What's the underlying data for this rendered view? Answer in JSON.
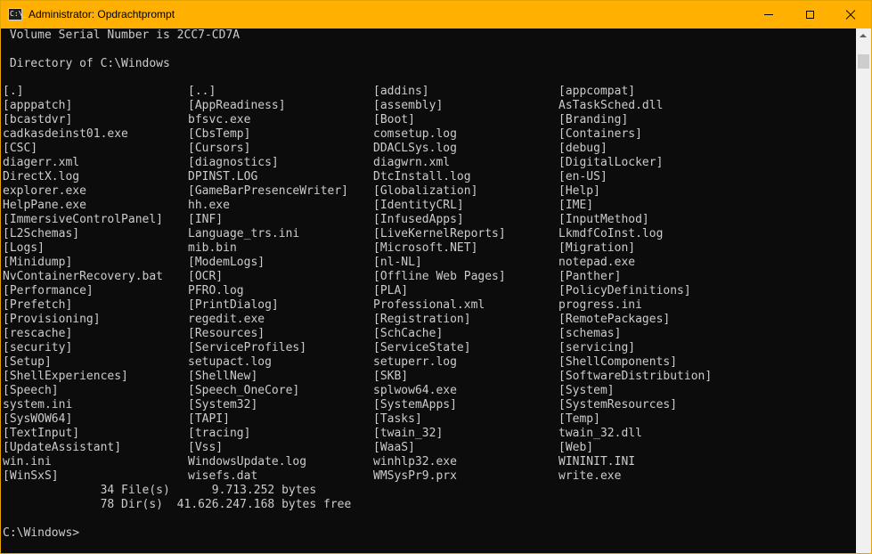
{
  "window": {
    "title": "Administrator: Opdrachtprompt",
    "icon": "cmd-icon",
    "icon_text": "C:\\_"
  },
  "colors": {
    "titlebar": "#ffb000",
    "console_bg": "#0c0c0c",
    "console_text": "#cccccc"
  },
  "console": {
    "serial_line": " Volume Serial Number is 2CC7-CD7A",
    "directory_line": " Directory of C:\\Windows",
    "entries": [
      "[.]",
      "[..]",
      "[addins]",
      "[appcompat]",
      "[apppatch]",
      "[AppReadiness]",
      "[assembly]",
      "AsTaskSched.dll",
      "[bcastdvr]",
      "bfsvc.exe",
      "[Boot]",
      "[Branding]",
      "cadkasdeinst01.exe",
      "[CbsTemp]",
      "comsetup.log",
      "[Containers]",
      "[CSC]",
      "[Cursors]",
      "DDACLSys.log",
      "[debug]",
      "diagerr.xml",
      "[diagnostics]",
      "diagwrn.xml",
      "[DigitalLocker]",
      "DirectX.log",
      "DPINST.LOG",
      "DtcInstall.log",
      "[en-US]",
      "explorer.exe",
      "[GameBarPresenceWriter]",
      "[Globalization]",
      "[Help]",
      "HelpPane.exe",
      "hh.exe",
      "[IdentityCRL]",
      "[IME]",
      "[ImmersiveControlPanel]",
      "[INF]",
      "[InfusedApps]",
      "[InputMethod]",
      "[L2Schemas]",
      "Language_trs.ini",
      "[LiveKernelReports]",
      "LkmdfCoInst.log",
      "[Logs]",
      "mib.bin",
      "[Microsoft.NET]",
      "[Migration]",
      "[Minidump]",
      "[ModemLogs]",
      "[nl-NL]",
      "notepad.exe",
      "NvContainerRecovery.bat",
      "[OCR]",
      "[Offline Web Pages]",
      "[Panther]",
      "[Performance]",
      "PFRO.log",
      "[PLA]",
      "[PolicyDefinitions]",
      "[Prefetch]",
      "[PrintDialog]",
      "Professional.xml",
      "progress.ini",
      "[Provisioning]",
      "regedit.exe",
      "[Registration]",
      "[RemotePackages]",
      "[rescache]",
      "[Resources]",
      "[SchCache]",
      "[schemas]",
      "[security]",
      "[ServiceProfiles]",
      "[ServiceState]",
      "[servicing]",
      "[Setup]",
      "setupact.log",
      "setuperr.log",
      "[ShellComponents]",
      "[ShellExperiences]",
      "[ShellNew]",
      "[SKB]",
      "[SoftwareDistribution]",
      "[Speech]",
      "[Speech_OneCore]",
      "splwow64.exe",
      "[System]",
      "system.ini",
      "[System32]",
      "[SystemApps]",
      "[SystemResources]",
      "[SysWOW64]",
      "[TAPI]",
      "[Tasks]",
      "[Temp]",
      "[TextInput]",
      "[tracing]",
      "[twain_32]",
      "twain_32.dll",
      "[UpdateAssistant]",
      "[Vss]",
      "[WaaS]",
      "[Web]",
      "win.ini",
      "WindowsUpdate.log",
      "winhlp32.exe",
      "WININIT.INI",
      "[WinSxS]",
      "wisefs.dat",
      "WMSysPr9.prx",
      "write.exe"
    ],
    "files_summary": "              34 File(s)      9.713.252 bytes",
    "dirs_summary": "              78 Dir(s)  41.626.247.168 bytes free",
    "prompt": "C:\\Windows>"
  }
}
